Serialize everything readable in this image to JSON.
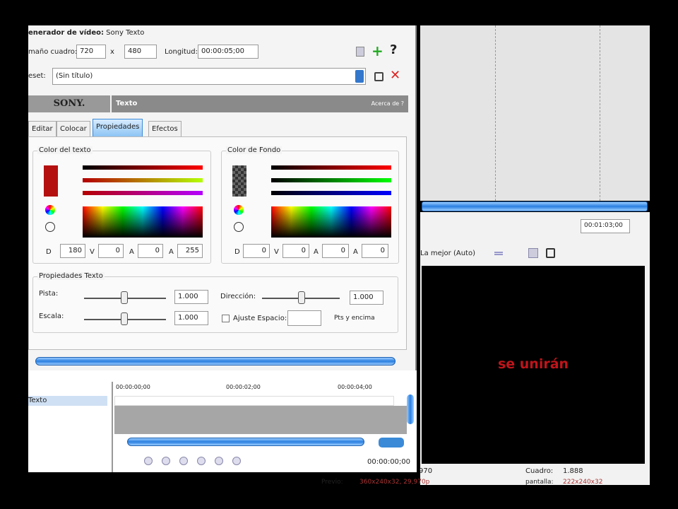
{
  "dialog": {
    "title_bold": "enerador de vídeo:",
    "title_rest": "Sony Texto",
    "frame_size_label": "maño cuadro:",
    "width": "720",
    "x_label": "x",
    "height": "480",
    "length_label": "Longitud:",
    "length": "00:00:05;00",
    "help": "?",
    "preset_label": "eset:",
    "preset_value": "(Sin título)",
    "brand": "SONY.",
    "plugin_name": "Texto",
    "about": "Acerca de ?",
    "tabs": [
      "Editar",
      "Colocar",
      "Propiedades",
      "Efectos"
    ],
    "text_color": {
      "title": "Color del texto",
      "d": "180",
      "v": "0",
      "a": "0",
      "alpha": "255",
      "labels": [
        "D",
        "V",
        "A",
        "A"
      ]
    },
    "bg_color": {
      "title": "Color de Fondo",
      "d": "0",
      "v": "0",
      "a": "0",
      "alpha": "0",
      "labels": [
        "D",
        "V",
        "A",
        "A"
      ]
    },
    "text_props": {
      "title": "Propiedades Texto",
      "pista_label": "Pista:",
      "pista": "1.000",
      "escala_label": "Escala:",
      "escala": "1.000",
      "direccion_label": "Dirección:",
      "direccion": "1.000",
      "ajuste_label": "Ajuste Espacio:",
      "ajuste_suffix": "Pts y encima"
    },
    "track_name": "Texto",
    "ruler": [
      "00:00:00;00",
      "00:00:02;00",
      "00:00:04;00"
    ],
    "timecode": "00:00:00;00"
  },
  "right": {
    "timecode": "00:01:03;00",
    "quality": "La mejor (Auto)",
    "preview_text": "se unirán",
    "preview_color": "#c0141a",
    "status": {
      "left": "970",
      "cuadro_label": "Cuadro:",
      "cuadro": "1.888",
      "previo_label": "Previo:",
      "previo": "360x240x32, 29,970p",
      "pantalla_label": "pantalla:",
      "pantalla": "222x240x32"
    }
  }
}
